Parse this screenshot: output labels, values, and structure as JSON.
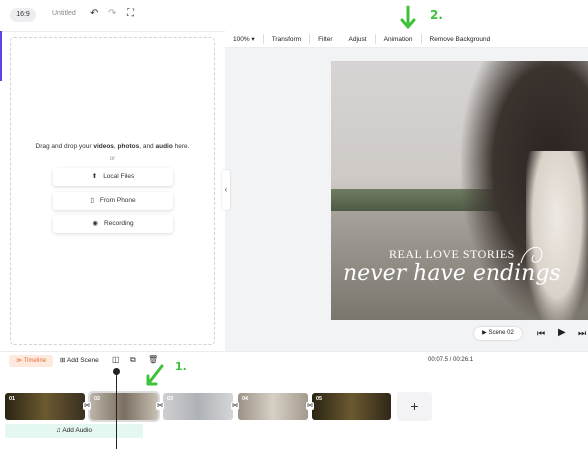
{
  "topbar": {
    "ratio": "16:9",
    "title": "Untitled"
  },
  "upload": {
    "drag_prefix": "Drag and drop your",
    "videos": "videos",
    "comma1": ",",
    "photos": "photos",
    "comma2": ", and",
    "audio": "audio",
    "drag_suffix": "here.",
    "or": "or",
    "local": "Local Files",
    "phone": "From Phone",
    "recording": "Recording"
  },
  "toolbar": {
    "zoom": "100%",
    "items": [
      "Transform",
      "Filter",
      "Adjust",
      "Animation",
      "Remove Background"
    ]
  },
  "canvas": {
    "line1": "REAL LOVE STORIES",
    "line2": "never have endings"
  },
  "player": {
    "scene": "Scene 02"
  },
  "timeline": {
    "tab": "Timeline",
    "add_scene": "Add Scene",
    "time": "00:07.5 / 00:26.1",
    "clips": [
      "01",
      "02",
      "03",
      "04",
      "05"
    ],
    "add_audio": "Add Audio"
  },
  "annotations": {
    "one": "1.",
    "two": "2."
  },
  "colors": {
    "accent": "#5b43e8",
    "timeline_tab": "#e8713a",
    "annotation": "#3ec23a"
  }
}
